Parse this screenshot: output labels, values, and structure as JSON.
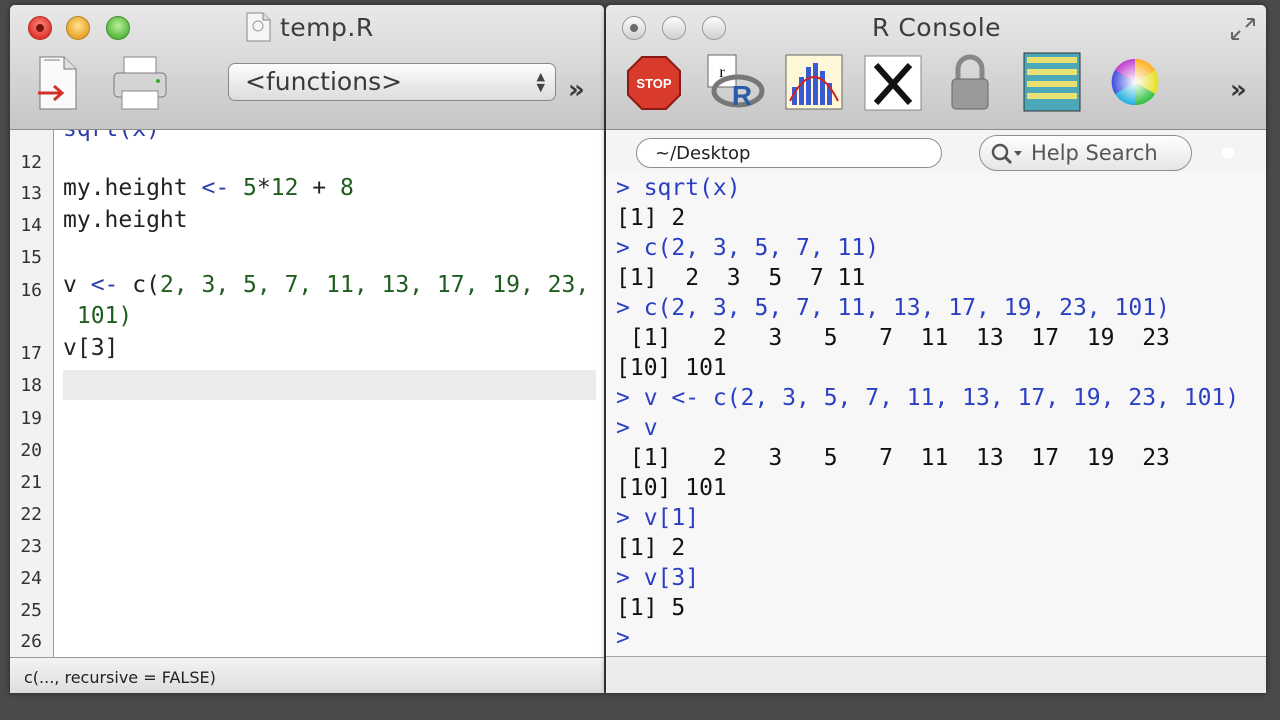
{
  "editor": {
    "title": "temp.R",
    "functions_select": "<functions>",
    "overflow": "»",
    "status": "c(..., recursive = FALSE)",
    "partial_line": "sqrt(x)",
    "line_numbers": [
      "12",
      "13",
      "14",
      "15",
      "16",
      "",
      "17",
      "18",
      "19",
      "20",
      "21",
      "22",
      "23",
      "24",
      "25",
      "26"
    ],
    "lines": {
      "l13": {
        "a": "my.height",
        "b": " <- ",
        "c": "5",
        "d": "*",
        "e": "12",
        "f": " + ",
        "g": "8"
      },
      "l14": "my.height",
      "l16a": {
        "a": "v",
        "b": " <- ",
        "c": "c(",
        "d": "2, 3, 5, 7, 11, 13, 17, 19, 23,"
      },
      "l16b": " 101)",
      "l17": "v[3]"
    }
  },
  "console": {
    "title": "R Console",
    "path": "~/Desktop",
    "help_search": "Help Search",
    "overflow": "»",
    "toolbar_icons": [
      "stop-icon",
      "source-script-icon",
      "quartz-graph-icon",
      "x11-icon",
      "lock-icon",
      "history-icon",
      "color-wheel-icon"
    ],
    "lines": [
      {
        "type": "input",
        "text": "> sqrt(x)"
      },
      {
        "type": "output",
        "text": "[1] 2"
      },
      {
        "type": "input",
        "text": "> c(2, 3, 5, 7, 11)"
      },
      {
        "type": "output",
        "text": "[1]  2  3  5  7 11"
      },
      {
        "type": "input",
        "text": "> c(2, 3, 5, 7, 11, 13, 17, 19, 23, 101)"
      },
      {
        "type": "output",
        "text": " [1]   2   3   5   7  11  13  17  19  23"
      },
      {
        "type": "output",
        "text": "[10] 101"
      },
      {
        "type": "input",
        "text": "> v <- c(2, 3, 5, 7, 11, 13, 17, 19, 23, 101)"
      },
      {
        "type": "input",
        "text": "> v"
      },
      {
        "type": "output",
        "text": " [1]   2   3   5   7  11  13  17  19  23"
      },
      {
        "type": "output",
        "text": "[10] 101"
      },
      {
        "type": "input",
        "text": "> v[1]"
      },
      {
        "type": "output",
        "text": "[1] 2"
      },
      {
        "type": "input",
        "text": "> v[3]"
      },
      {
        "type": "output",
        "text": "[1] 5"
      },
      {
        "type": "input",
        "text": ">"
      }
    ]
  }
}
